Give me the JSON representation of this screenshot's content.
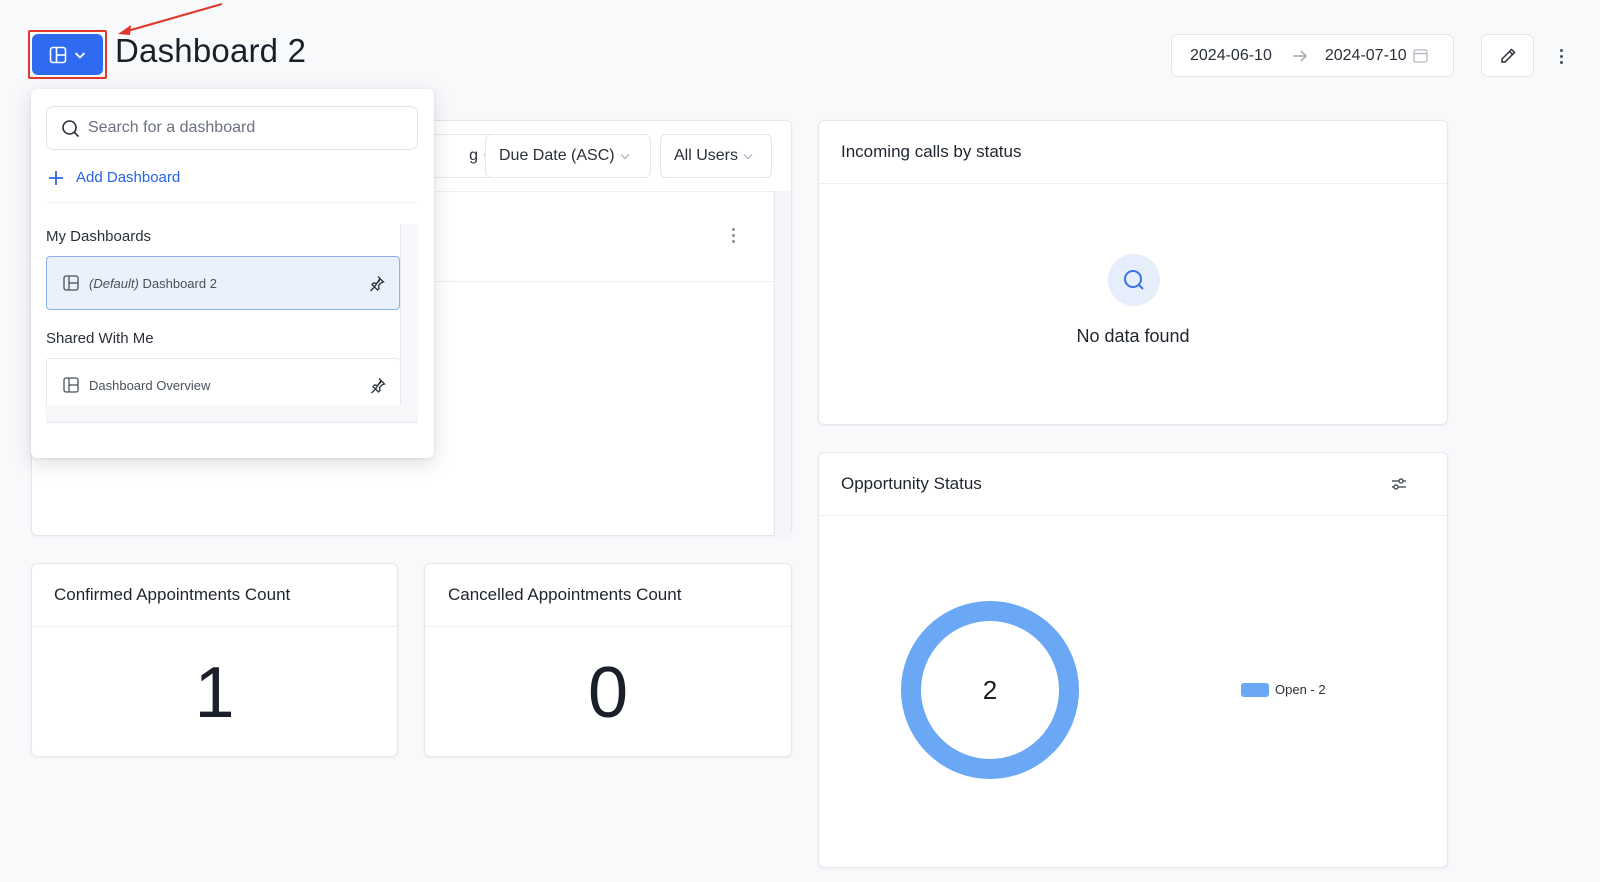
{
  "header": {
    "title": "Dashboard 2",
    "date_start": "2024-06-10",
    "date_end": "2024-07-10",
    "switcher_icon": "layout-icon",
    "accent_color": "#2f6bf0",
    "highlight_color": "#e0392b"
  },
  "filters": {
    "partial_label": "g",
    "sort_label": "Due Date (ASC)",
    "users_label": "All Users"
  },
  "dropdown": {
    "search_placeholder": "Search for a dashboard",
    "add_label": "Add Dashboard",
    "my_section": "My Dashboards",
    "my_items": [
      {
        "prefix": "(Default)",
        "label": "Dashboard 2"
      }
    ],
    "shared_section": "Shared With Me",
    "shared_items": [
      {
        "label": "Dashboard Overview"
      }
    ]
  },
  "cards": {
    "calls": {
      "title": "Incoming calls by status",
      "empty_text": "No data found"
    },
    "opportunity": {
      "title": "Opportunity Status",
      "center_value": "2",
      "legend_label": "Open - 2"
    },
    "confirmed": {
      "title": "Confirmed Appointments Count",
      "value": "1"
    },
    "cancelled": {
      "title": "Cancelled Appointments Count",
      "value": "0"
    }
  },
  "chart_data": {
    "type": "pie",
    "categories": [
      "Open"
    ],
    "values": [
      2
    ],
    "colors": [
      "#6aa8f5"
    ],
    "donut": true,
    "legend": "right"
  }
}
